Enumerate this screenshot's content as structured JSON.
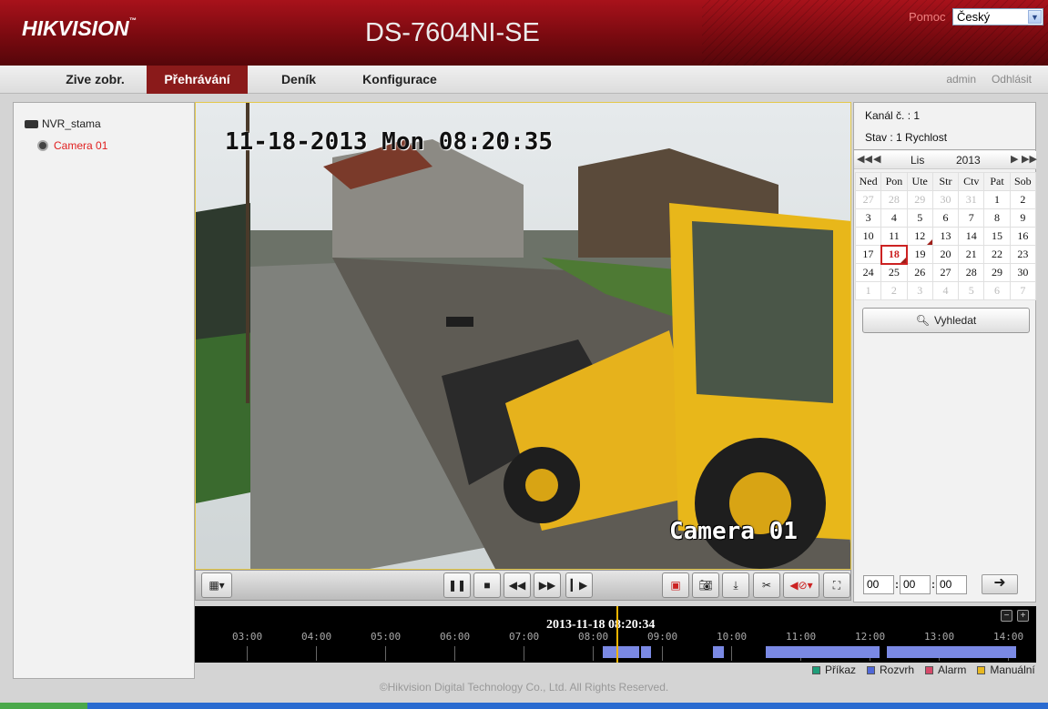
{
  "header": {
    "brand": "HIKVISION",
    "brand_tm": "™",
    "model": "DS-7604NI-SE",
    "help_label": "Pomoc",
    "language_value": "Český"
  },
  "nav": {
    "tabs": [
      {
        "label": "Zive zobr."
      },
      {
        "label": "Přehrávání",
        "active": true
      },
      {
        "label": "Deník"
      },
      {
        "label": "Konfigurace"
      }
    ],
    "user": "admin",
    "logout": "Odhlásit"
  },
  "tree": {
    "root": "NVR_stama",
    "camera": "Camera 01"
  },
  "video": {
    "osd_timestamp": "11-18-2013 Mon 08:20:35",
    "osd_camera": "Camera 01"
  },
  "controls": {
    "buttons": [
      "layout-icon",
      "pause-icon",
      "stop-icon",
      "rewind-icon",
      "fast-forward-icon",
      "frame-step-icon",
      "stop-all-icon",
      "snapshot-icon",
      "download-icon",
      "clip-icon",
      "audio-mute-icon",
      "fullscreen-icon"
    ]
  },
  "info": {
    "channel": "Kanál č. : 1",
    "status": "Stav : 1 Rychlost"
  },
  "calendar": {
    "month": "Lis",
    "year": "2013",
    "weekdays": [
      "Ned",
      "Pon",
      "Ute",
      "Str",
      "Ctv",
      "Pat",
      "Sob"
    ],
    "weeks": [
      [
        "27",
        "28",
        "29",
        "30",
        "31",
        "1",
        "2"
      ],
      [
        "3",
        "4",
        "5",
        "6",
        "7",
        "8",
        "9"
      ],
      [
        "10",
        "11",
        "12",
        "13",
        "14",
        "15",
        "16"
      ],
      [
        "17",
        "18",
        "19",
        "20",
        "21",
        "22",
        "23"
      ],
      [
        "24",
        "25",
        "26",
        "27",
        "28",
        "29",
        "30"
      ],
      [
        "1",
        "2",
        "3",
        "4",
        "5",
        "6",
        "7"
      ]
    ],
    "selected_day": "18",
    "recorded_days": [
      "12",
      "18"
    ]
  },
  "search": {
    "label": "Vyhledat"
  },
  "time_input": {
    "hh": "00",
    "mm": "00",
    "ss": "00"
  },
  "timeline": {
    "current_time": "2013-11-18 08:20:34",
    "hours": [
      "03:00",
      "04:00",
      "05:00",
      "06:00",
      "07:00",
      "08:00",
      "09:00",
      "10:00",
      "11:00",
      "12:00",
      "13:00",
      "14:00"
    ],
    "legend": [
      {
        "label": "Příkaz",
        "color": "#1f9e7a"
      },
      {
        "label": "Rozvrh",
        "color": "#5068d8"
      },
      {
        "label": "Alarm",
        "color": "#d64a6a"
      },
      {
        "label": "Manuální",
        "color": "#e8b820"
      }
    ]
  },
  "footer": "©Hikvision Digital Technology Co., Ltd. All Rights Reserved."
}
